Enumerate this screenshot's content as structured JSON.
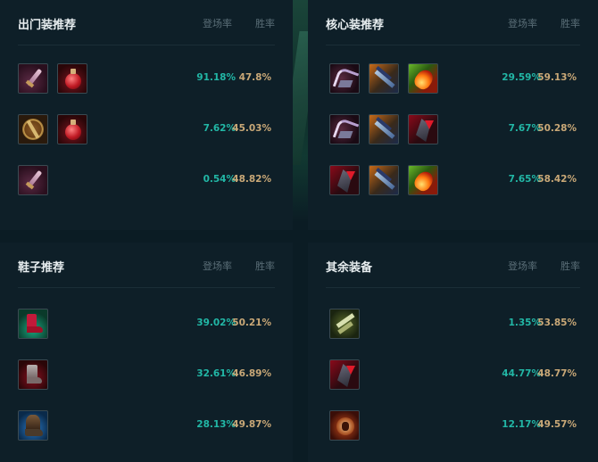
{
  "sections": {
    "starting": {
      "title": "出门装推荐",
      "col_pick": "登场率",
      "col_win": "胜率",
      "rows": [
        {
          "items": [
            "dagger-icon",
            "potion-icon"
          ],
          "pick": "91.18%",
          "win": "47.8%"
        },
        {
          "items": [
            "shield-icon",
            "potion-icon"
          ],
          "pick": "7.62%",
          "win": "45.03%"
        },
        {
          "items": [
            "dagger-icon"
          ],
          "pick": "0.54%",
          "win": "48.82%"
        }
      ]
    },
    "core": {
      "title": "核心装推荐",
      "col_pick": "登场率",
      "col_win": "胜率",
      "rows": [
        {
          "items": [
            "claw-icon",
            "bow-icon",
            "fire-icon"
          ],
          "pick": "29.59%",
          "win": "59.13%"
        },
        {
          "items": [
            "claw-icon",
            "bow-icon",
            "crimson-icon"
          ],
          "pick": "7.67%",
          "win": "50.28%"
        },
        {
          "items": [
            "crimson-icon",
            "bow-icon",
            "fire-icon"
          ],
          "pick": "7.65%",
          "win": "58.42%"
        }
      ]
    },
    "boots": {
      "title": "鞋子推荐",
      "col_pick": "登场率",
      "col_win": "胜率",
      "rows": [
        {
          "items": [
            "boot-green-icon"
          ],
          "pick": "39.02%",
          "win": "50.21%"
        },
        {
          "items": [
            "boot-red-icon"
          ],
          "pick": "32.61%",
          "win": "46.89%"
        },
        {
          "items": [
            "boot-blue-icon"
          ],
          "pick": "28.13%",
          "win": "49.87%"
        }
      ]
    },
    "other": {
      "title": "其余装备",
      "col_pick": "登场率",
      "col_win": "胜率",
      "rows": [
        {
          "items": [
            "olive-icon"
          ],
          "pick": "1.35%",
          "win": "53.85%"
        },
        {
          "items": [
            "crimson-icon"
          ],
          "pick": "44.77%",
          "win": "48.77%"
        },
        {
          "items": [
            "ember-icon"
          ],
          "pick": "12.17%",
          "win": "49.57%"
        }
      ]
    }
  },
  "colors": {
    "background": "#0b1c24",
    "panel": "#0e1f28",
    "pick_rate": "#22b7a6",
    "win_rate": "#c9a877",
    "title": "#e8eef0",
    "header_muted": "#5a6e77"
  }
}
